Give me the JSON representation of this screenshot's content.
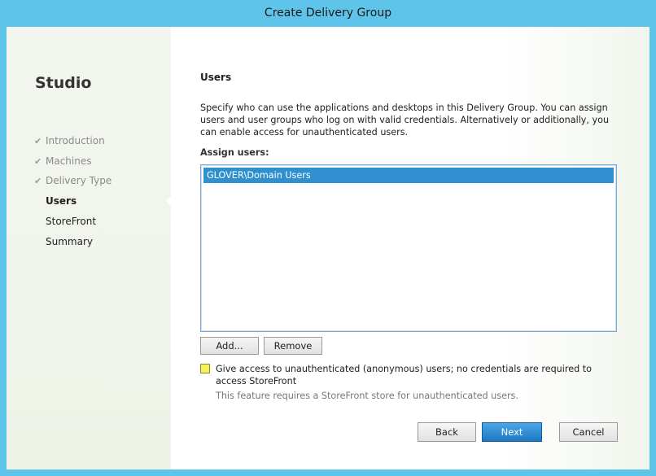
{
  "window": {
    "title": "Create Delivery Group"
  },
  "sidebar": {
    "brand": "Studio",
    "steps": [
      {
        "label": "Introduction",
        "state": "done",
        "check": "✔"
      },
      {
        "label": "Machines",
        "state": "done",
        "check": "✔"
      },
      {
        "label": "Delivery Type",
        "state": "done",
        "check": "✔"
      },
      {
        "label": "Users",
        "state": "current"
      },
      {
        "label": "StoreFront",
        "state": "pending"
      },
      {
        "label": "Summary",
        "state": "pending"
      }
    ]
  },
  "main": {
    "heading": "Users",
    "description": "Specify who can use the applications and desktops in this Delivery Group. You can assign users and user groups who log on with valid credentials. Alternatively or additionally, you can enable access for unauthenticated users.",
    "assign_label": "Assign users:",
    "assigned_users": [
      "GLOVER\\Domain Users"
    ],
    "add_label": "Add...",
    "remove_label": "Remove",
    "anonymous_checkbox_label": "Give access to unauthenticated (anonymous) users; no credentials are required to access StoreFront",
    "anonymous_note": "This feature requires a StoreFront store for unauthenticated users."
  },
  "footer": {
    "back_label": "Back",
    "next_label": "Next",
    "cancel_label": "Cancel"
  },
  "colors": {
    "window_frame": "#5fc4ea",
    "selection": "#2f8fcf",
    "primary_button": "#1d78c4",
    "checkbox_fill": "#f6f25a"
  }
}
